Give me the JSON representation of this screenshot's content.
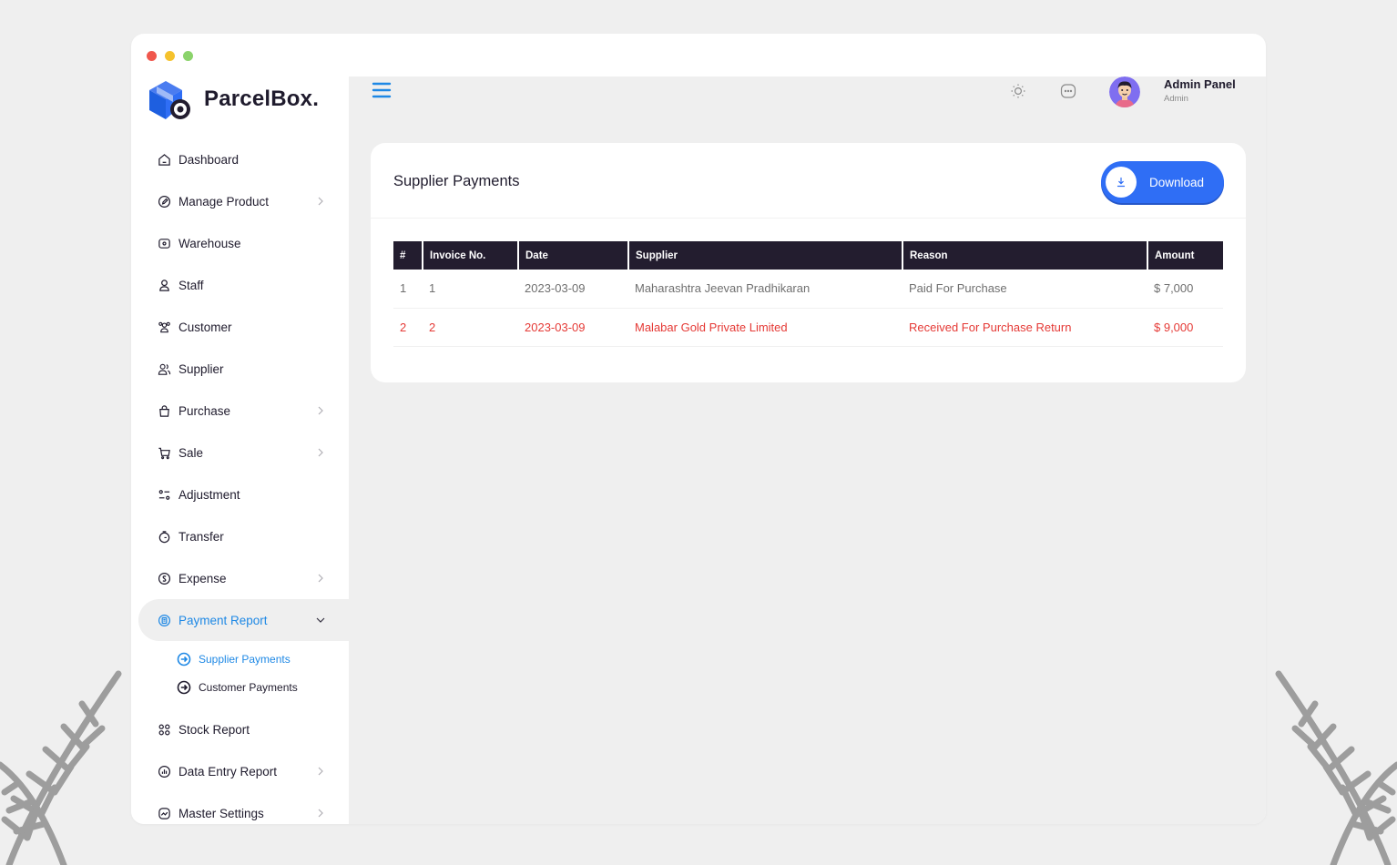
{
  "brand": {
    "name": "ParcelBox."
  },
  "sidebar": {
    "items": [
      {
        "label": "Dashboard",
        "icon": "home-icon",
        "chevron": false
      },
      {
        "label": "Manage Product",
        "icon": "edit-icon",
        "chevron": true
      },
      {
        "label": "Warehouse",
        "icon": "warehouse-icon",
        "chevron": false
      },
      {
        "label": "Staff",
        "icon": "user-icon",
        "chevron": false
      },
      {
        "label": "Customer",
        "icon": "users-icon",
        "chevron": false
      },
      {
        "label": "Supplier",
        "icon": "supplier-icon",
        "chevron": false
      },
      {
        "label": "Purchase",
        "icon": "bag-icon",
        "chevron": true
      },
      {
        "label": "Sale",
        "icon": "cart-icon",
        "chevron": true
      },
      {
        "label": "Adjustment",
        "icon": "adjust-icon",
        "chevron": false
      },
      {
        "label": "Transfer",
        "icon": "transfer-icon",
        "chevron": false
      },
      {
        "label": "Expense",
        "icon": "expense-icon",
        "chevron": true
      }
    ],
    "active_item": {
      "label": "Payment Report",
      "icon": "report-icon"
    },
    "sub_items": [
      {
        "label": "Supplier Payments",
        "active": true
      },
      {
        "label": "Customer Payments",
        "active": false
      }
    ],
    "items_after": [
      {
        "label": "Stock Report",
        "icon": "grid-icon",
        "chevron": false
      },
      {
        "label": "Data Entry Report",
        "icon": "chart-icon",
        "chevron": true
      },
      {
        "label": "Master Settings",
        "icon": "settings-icon",
        "chevron": true
      }
    ]
  },
  "topbar": {
    "user_name": "Admin Panel",
    "user_role": "Admin"
  },
  "card": {
    "title": "Supplier Payments",
    "download_label": "Download"
  },
  "table": {
    "headers": [
      "#",
      "Invoice No.",
      "Date",
      "Supplier",
      "Reason",
      "Amount"
    ],
    "rows": [
      {
        "cells": [
          "1",
          "1",
          "2023-03-09",
          "Maharashtra Jeevan Pradhikaran",
          "Paid For Purchase",
          "$ 7,000"
        ],
        "highlight": false
      },
      {
        "cells": [
          "2",
          "2",
          "2023-03-09",
          "Malabar Gold Private Limited",
          "Received For Purchase Return",
          "$ 9,000"
        ],
        "highlight": true
      }
    ]
  },
  "colors": {
    "accent": "#1e88e5",
    "button": "#2f6ef5",
    "table_header": "#231d2f",
    "highlight_text": "#e53935"
  }
}
